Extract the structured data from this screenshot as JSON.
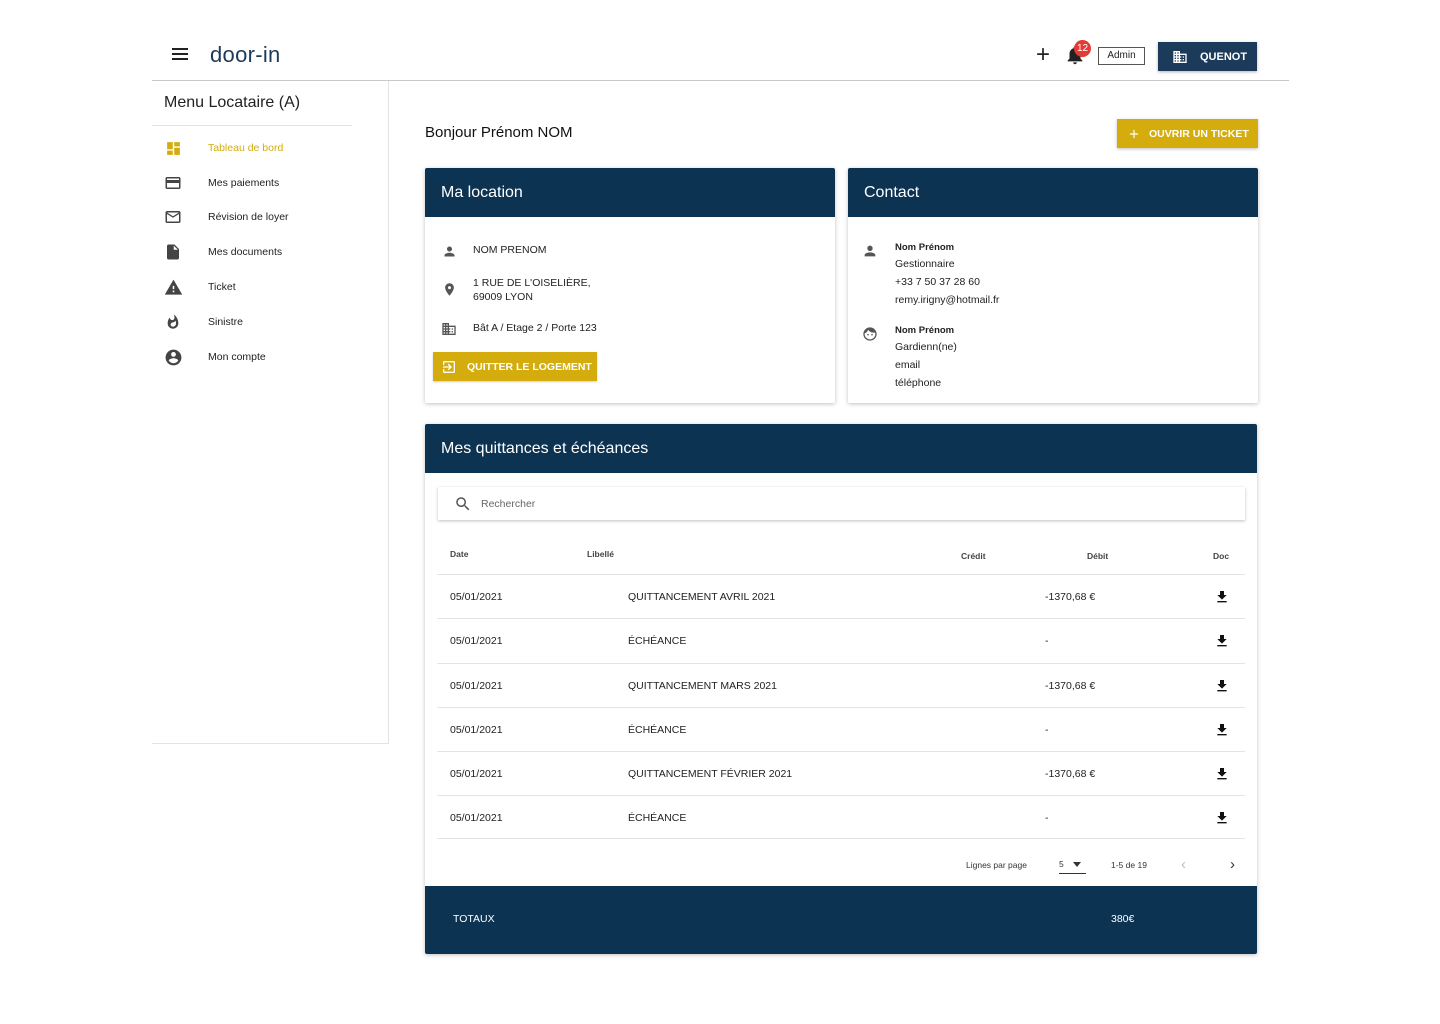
{
  "header": {
    "logo": "door-in",
    "notifications_count": "12",
    "admin_label": "Admin",
    "org_label": "QUENOT"
  },
  "sidebar": {
    "title": "Menu Locataire (A)",
    "items": [
      {
        "label": "Tableau de bord",
        "icon": "dashboard-icon",
        "active": true
      },
      {
        "label": "Mes paiements",
        "icon": "credit-card-icon"
      },
      {
        "label": "Révision de loyer",
        "icon": "mail-icon"
      },
      {
        "label": "Mes documents",
        "icon": "document-icon"
      },
      {
        "label": "Ticket",
        "icon": "warning-icon"
      },
      {
        "label": "Sinistre",
        "icon": "fire-icon"
      },
      {
        "label": "Mon compte",
        "icon": "account-circle-icon"
      }
    ]
  },
  "main": {
    "greeting": "Bonjour Prénom NOM",
    "open_ticket_label": "OUVRIR UN TICKET"
  },
  "location": {
    "title": "Ma location",
    "name": "NOM PRENOM",
    "address_line1": "1 RUE DE L'OISELIÈRE,",
    "address_line2": "69009 LYON",
    "building": "Bât A / Etage 2 / Porte 123",
    "quit_label": "QUITTER LE LOGEMENT"
  },
  "contact": {
    "title": "Contact",
    "people": [
      {
        "name": "Nom Prénom",
        "role": "Gestionnaire",
        "phone": "+33 7 50 37 28 60",
        "email": "remy.irigny@hotmail.fr"
      },
      {
        "name": "Nom Prénom",
        "role": "Gardienn(ne)",
        "phone": "email",
        "email": "téléphone"
      }
    ]
  },
  "quittances": {
    "title": "Mes quittances et échéances",
    "search_placeholder": "Rechercher",
    "columns": {
      "date": "Date",
      "libelle": "Libellé",
      "credit": "Crédit",
      "debit": "Débit",
      "doc": "Doc"
    },
    "rows": [
      {
        "date": "05/01/2021",
        "libelle": "QUITTANCEMENT AVRIL 2021",
        "credit": "",
        "debit": "-1370,68 €"
      },
      {
        "date": "05/01/2021",
        "libelle": "ÉCHÉANCE",
        "credit": "",
        "debit": "-"
      },
      {
        "date": "05/01/2021",
        "libelle": "QUITTANCEMENT MARS 2021",
        "credit": "",
        "debit": "-1370,68 €"
      },
      {
        "date": "05/01/2021",
        "libelle": "ÉCHÉANCE",
        "credit": "",
        "debit": "-"
      },
      {
        "date": "05/01/2021",
        "libelle": "QUITTANCEMENT FÉVRIER 2021",
        "credit": "",
        "debit": "-1370,68 €"
      },
      {
        "date": "05/01/2021",
        "libelle": "ÉCHÉANCE",
        "credit": "",
        "debit": "-"
      }
    ],
    "pagination": {
      "rows_per_page_label": "Lignes par page",
      "rows_per_page": "5",
      "range": "1-5 de 19"
    },
    "totals": {
      "label": "TOTAUX",
      "value": "380€"
    }
  },
  "colors": {
    "navy": "#0d3352",
    "gold": "#d4ac0d",
    "badge": "#e53935"
  }
}
